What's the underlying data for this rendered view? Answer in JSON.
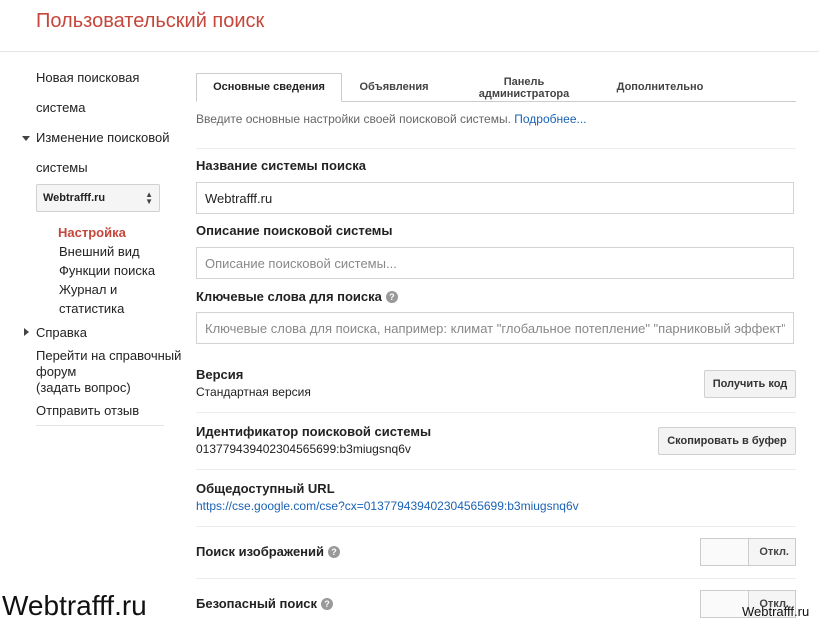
{
  "header": {
    "title": "Пользовательский поиск"
  },
  "sidebar": {
    "new_engine_line1": "Новая поисковая",
    "new_engine_line2": "система",
    "edit_engine_line1": "Изменение поисковой",
    "edit_engine_line2": "системы",
    "engine_select_value": "Webtrafff.ru",
    "subitems": [
      "Настройка",
      "Внешний вид",
      "Функции поиска",
      "Журнал и",
      "статистика"
    ],
    "help_label": "Справка",
    "forum_line1": "Перейти на справочный",
    "forum_line2": "форум",
    "forum_line3": "(задать вопрос)",
    "feedback_label": "Отправить отзыв"
  },
  "tabs": {
    "basics": "Основные сведения",
    "ads": "Объявления",
    "admin_line1": "Панель",
    "admin_line2": "администратора",
    "advanced": "Дополнительно"
  },
  "intro": {
    "text": "Введите основные настройки своей поисковой системы. ",
    "link": "Подробнее..."
  },
  "form": {
    "name_label": "Название системы поиска",
    "name_value": "Webtrafff.ru",
    "description_label": "Описание поисковой системы",
    "description_placeholder": "Описание поисковой системы...",
    "keywords_label": "Ключевые слова для поиска",
    "keywords_placeholder": "Ключевые слова для поиска, например: климат \"глобальное потепление\" \"парниковый эффект\"",
    "version_label": "Версия",
    "version_value": "Стандартная версия",
    "get_code_button": "Получить код",
    "engine_id_label": "Идентификатор поисковой системы",
    "engine_id_value": "013779439402304565699:b3miugsnq6v",
    "copy_button": "Скопировать в буфер",
    "public_url_label": "Общедоступный URL",
    "public_url_value": "https://cse.google.com/cse?cx=013779439402304565699:b3miugsnq6v",
    "image_search_label": "Поиск изображений",
    "image_search_state": "Откл.",
    "safe_search_label": "Безопасный поиск",
    "safe_search_state": "Откл."
  },
  "watermark": {
    "left": "Webtrafff.ru",
    "right": "Webtrafff.ru"
  },
  "colors": {
    "title": "#c5463a",
    "link": "#1a62b5",
    "active_nav": "#c5463a"
  }
}
